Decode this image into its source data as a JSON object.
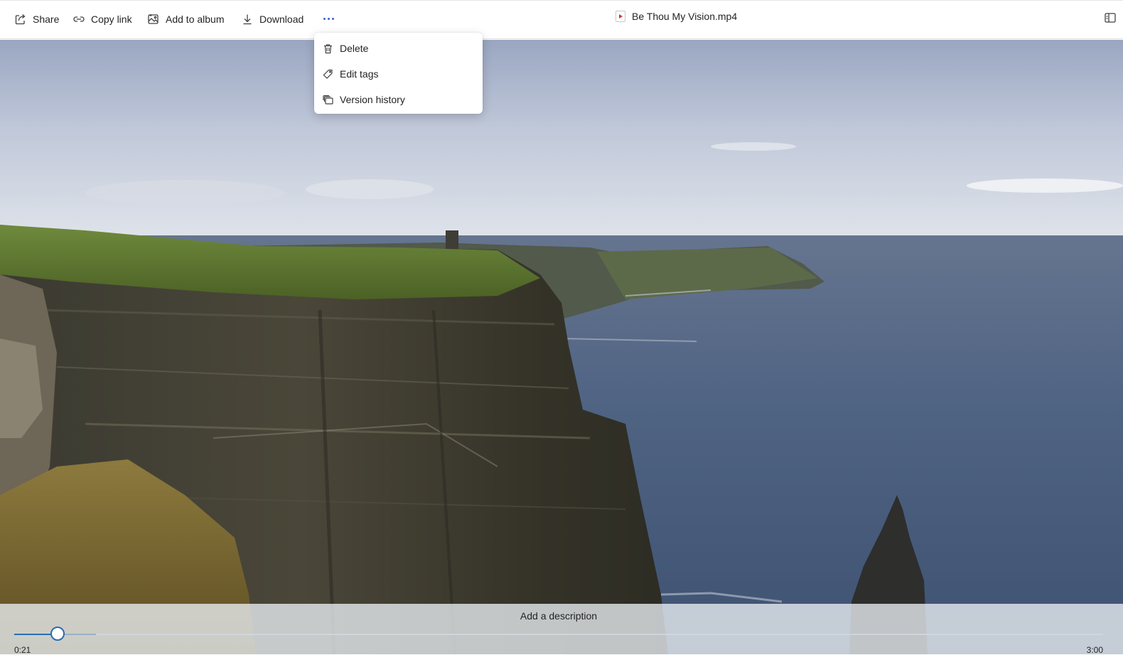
{
  "toolbar": {
    "share_label": "Share",
    "copy_link_label": "Copy link",
    "add_to_album_label": "Add to album",
    "download_label": "Download",
    "more_icon": "more-horizontal-icon"
  },
  "file": {
    "title": "Be Thou My Vision.mp4",
    "type_icon": "video-file-icon"
  },
  "menu": {
    "items": [
      {
        "label": "Delete",
        "icon": "trash-icon"
      },
      {
        "label": "Edit tags",
        "icon": "tag-icon"
      },
      {
        "label": "Version history",
        "icon": "version-history-icon"
      }
    ]
  },
  "player": {
    "description_placeholder": "Add a description",
    "current_time": "0:21",
    "total_time": "3:00",
    "progress_fraction": 0.04,
    "buffered_fraction": 0.075
  },
  "colors": {
    "accent": "#2b6cb0",
    "more_dots": "#3a63c9"
  }
}
